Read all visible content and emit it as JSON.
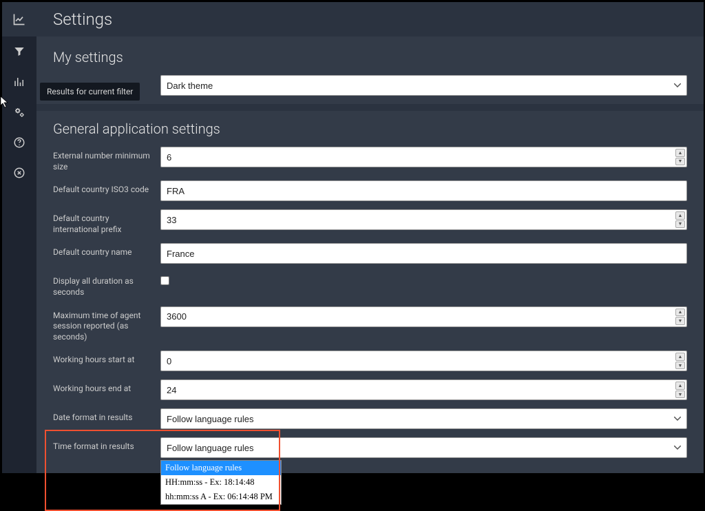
{
  "header": {
    "title": "Settings"
  },
  "tooltip": "Results for current filter",
  "sections": {
    "my_settings_title": "My settings",
    "general_title": "General application settings"
  },
  "theme": {
    "value": "Dark theme"
  },
  "fields": {
    "ext_num_min": {
      "label": "External number minimum size",
      "value": "6"
    },
    "iso3": {
      "label": "Default country ISO3 code",
      "value": "FRA"
    },
    "intl_prefix": {
      "label": "Default country international prefix",
      "value": "33"
    },
    "country_name": {
      "label": "Default country name",
      "value": "France"
    },
    "dur_seconds": {
      "label": "Display all duration as seconds"
    },
    "max_session": {
      "label": "Maximum time of agent session reported (as seconds)",
      "value": "3600"
    },
    "work_start": {
      "label": "Working hours start at",
      "value": "0"
    },
    "work_end": {
      "label": "Working hours end at",
      "value": "24"
    },
    "date_format": {
      "label": "Date format in results",
      "value": "Follow language rules"
    },
    "time_format": {
      "label": "Time format in results",
      "value": "Follow language rules"
    }
  },
  "time_format_options": [
    "Follow language rules",
    "HH:mm:ss - Ex: 18:14:48",
    "hh:mm:ss A - Ex: 06:14:48 PM"
  ]
}
